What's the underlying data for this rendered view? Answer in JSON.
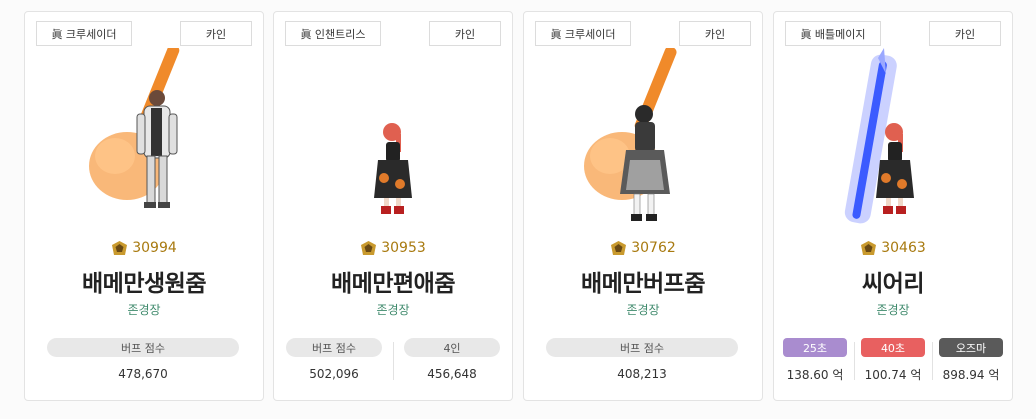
{
  "cards": [
    {
      "job": "眞 크루세이더",
      "server": "카인",
      "fame": "30994",
      "name": "배메만생원줌",
      "title": "존경장",
      "buff_label": "버프 점수",
      "buff_value": "478,670"
    },
    {
      "job": "眞 인챈트리스",
      "server": "카인",
      "fame": "30953",
      "name": "배메만편애줌",
      "title": "존경장",
      "buff_label": "버프 점수",
      "buff_value": "502,096",
      "party_label": "4인",
      "party_value": "456,648"
    },
    {
      "job": "眞 크루세이더",
      "server": "카인",
      "fame": "30762",
      "name": "배메만버프줌",
      "title": "존경장",
      "buff_label": "버프 점수",
      "buff_value": "408,213"
    },
    {
      "job": "眞 배틀메이지",
      "server": "카인",
      "fame": "30463",
      "name": "씨어리",
      "title": "존경장",
      "dmg": [
        {
          "label": "25초",
          "value": "138.60 억",
          "color": "#a98ccf"
        },
        {
          "label": "40초",
          "value": "100.74 억",
          "color": "#e86060"
        },
        {
          "label": "오즈마",
          "value": "898.94 억",
          "color": "#5a5a5a"
        }
      ]
    }
  ],
  "icons": {
    "fame": "fame-medal-icon"
  }
}
